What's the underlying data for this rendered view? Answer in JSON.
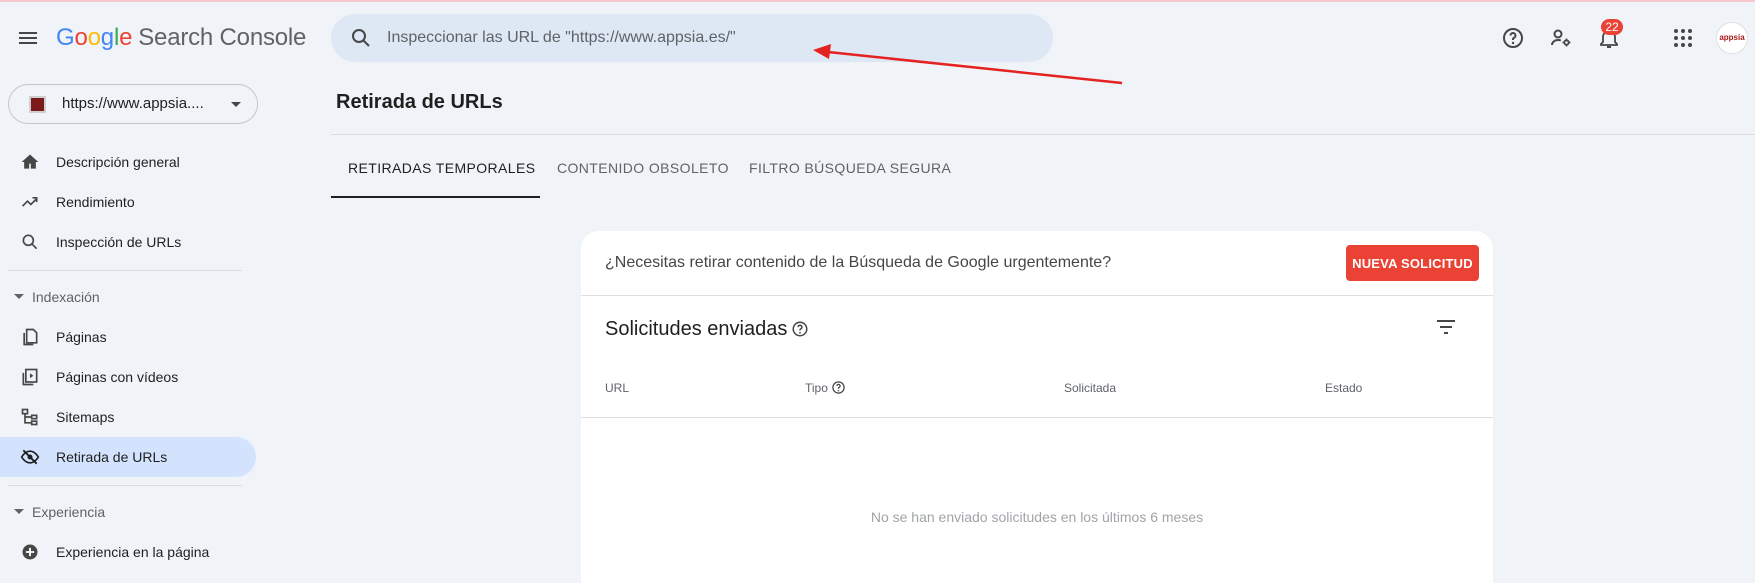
{
  "header": {
    "logo_letters": [
      "G",
      "o",
      "o",
      "g",
      "l",
      "e"
    ],
    "product": "Search Console",
    "search_placeholder": "Inspeccionar las URL de \"https://www.appsia.es/\"",
    "notifications_count": "22",
    "avatar_text": "appsia",
    "icons": [
      "menu-icon",
      "search-icon",
      "help-icon",
      "settings-user-icon",
      "notifications-icon",
      "apps-grid-icon"
    ]
  },
  "property": {
    "label": "https://www.appsia...."
  },
  "sidebar": {
    "items": [
      {
        "label": "Descripción general",
        "icon": "home-icon"
      },
      {
        "label": "Rendimiento",
        "icon": "trending-icon"
      },
      {
        "label": "Inspección de URLs",
        "icon": "search-icon"
      },
      {
        "label": "Páginas",
        "icon": "pages-icon"
      },
      {
        "label": "Páginas con vídeos",
        "icon": "video-pages-icon"
      },
      {
        "label": "Sitemaps",
        "icon": "sitemap-icon"
      },
      {
        "label": "Retirada de URLs",
        "icon": "eye-off-icon",
        "active": true
      },
      {
        "label": "Experiencia en la página",
        "icon": "plus-circle-icon"
      }
    ],
    "sections": [
      {
        "label": "Indexación"
      },
      {
        "label": "Experiencia"
      }
    ]
  },
  "main": {
    "title": "Retirada de URLs",
    "tabs": [
      {
        "label": "RETIRADAS TEMPORALES",
        "active": true
      },
      {
        "label": "CONTENIDO OBSOLETO"
      },
      {
        "label": "FILTRO BÚSQUEDA SEGURA"
      }
    ],
    "card": {
      "urgent_text": "¿Necesitas retirar contenido de la Búsqueda de Google urgentemente?",
      "new_request_label": "NUEVA SOLICITUD",
      "sent_title": "Solicitudes enviadas",
      "columns": [
        "URL",
        "Tipo",
        "Solicitada",
        "Estado"
      ],
      "empty_text": "No se han enviado solicitudes en los últimos 6 meses"
    }
  },
  "colors": {
    "accent_red": "#ea4335",
    "active_nav": "#d3e3fd",
    "background": "#f0f4f9",
    "annotation_arrow": "#e52222"
  }
}
